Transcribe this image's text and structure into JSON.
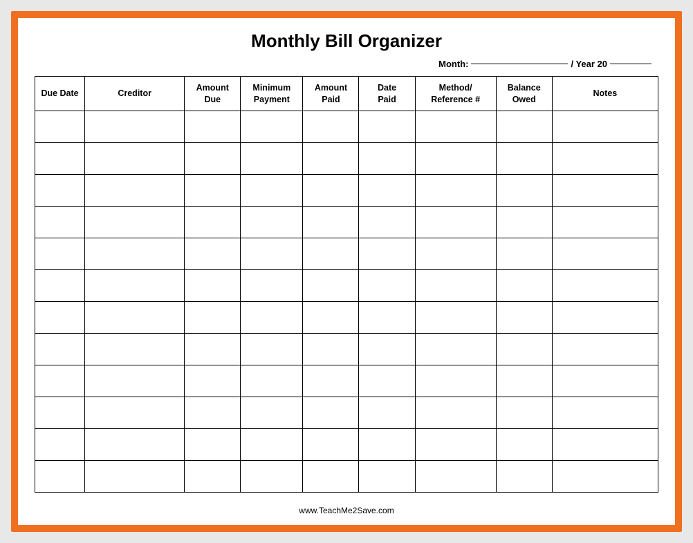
{
  "title": "Monthly Bill Organizer",
  "month_label": "Month:",
  "year_label": "/ Year 20",
  "footer": "www.TeachMe2Save.com",
  "columns": [
    {
      "id": "due-date",
      "line1": "Due Date",
      "line2": ""
    },
    {
      "id": "creditor",
      "line1": "Creditor",
      "line2": ""
    },
    {
      "id": "amount-due",
      "line1": "Amount",
      "line2": "Due"
    },
    {
      "id": "min-payment",
      "line1": "Minimum",
      "line2": "Payment"
    },
    {
      "id": "amount-paid",
      "line1": "Amount",
      "line2": "Paid"
    },
    {
      "id": "date-paid",
      "line1": "Date",
      "line2": "Paid"
    },
    {
      "id": "method-ref",
      "line1": "Method/",
      "line2": "Reference #"
    },
    {
      "id": "balance-owed",
      "line1": "Balance",
      "line2": "Owed"
    },
    {
      "id": "notes",
      "line1": "Notes",
      "line2": ""
    }
  ],
  "num_rows": 12
}
